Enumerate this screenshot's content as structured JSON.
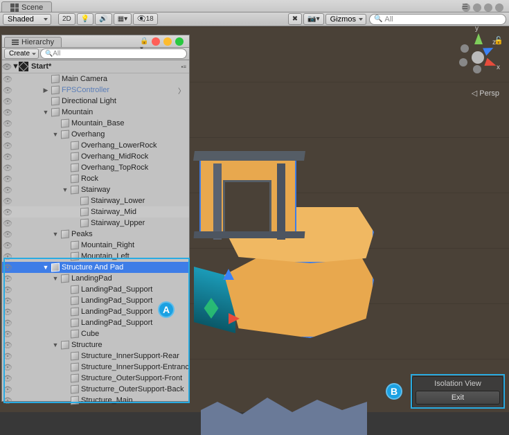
{
  "scene_tab": "Scene",
  "render_mode": "Shaded",
  "btn_2d": "2D",
  "gizmo_count": "18",
  "gizmos_label": "Gizmos",
  "search_placeholder": "All",
  "hierarchy_tab": "Hierarchy",
  "create_label": "Create",
  "hier_search_placeholder": "All",
  "scene_name": "Start*",
  "persp": "Persp",
  "axis_y": "y",
  "axis_x": "x",
  "axis_z": "z",
  "isolation_title": "Isolation View",
  "isolation_exit": "Exit",
  "marker_a": "A",
  "marker_b": "B",
  "tree": [
    {
      "d": 1,
      "name": "Main Camera",
      "arr": "",
      "link": false
    },
    {
      "d": 1,
      "name": "FPSController",
      "arr": "▶",
      "link": true,
      "chev": true
    },
    {
      "d": 1,
      "name": "Directional Light",
      "arr": "",
      "link": false
    },
    {
      "d": 1,
      "name": "Mountain",
      "arr": "▼",
      "link": false
    },
    {
      "d": 2,
      "name": "Mountain_Base",
      "arr": "",
      "link": false
    },
    {
      "d": 2,
      "name": "Overhang",
      "arr": "▼",
      "link": false
    },
    {
      "d": 3,
      "name": "Overhang_LowerRock",
      "arr": "",
      "link": false
    },
    {
      "d": 3,
      "name": "Overhang_MidRock",
      "arr": "",
      "link": false
    },
    {
      "d": 3,
      "name": "Overhang_TopRock",
      "arr": "",
      "link": false
    },
    {
      "d": 3,
      "name": "Rock",
      "arr": "",
      "link": false
    },
    {
      "d": 3,
      "name": "Stairway",
      "arr": "▼",
      "link": false
    },
    {
      "d": 4,
      "name": "Stairway_Lower",
      "arr": "",
      "link": false
    },
    {
      "d": 4,
      "name": "Stairway_Mid",
      "arr": "",
      "link": false,
      "hl": true
    },
    {
      "d": 4,
      "name": "Stairway_Upper",
      "arr": "",
      "link": false
    },
    {
      "d": 2,
      "name": "Peaks",
      "arr": "▼",
      "link": false
    },
    {
      "d": 3,
      "name": "Mountain_Right",
      "arr": "",
      "link": false
    },
    {
      "d": 3,
      "name": "Mountain_Left",
      "arr": "",
      "link": false
    },
    {
      "d": 1,
      "name": "Structure And Pad",
      "arr": "▼",
      "link": false,
      "sel": true
    },
    {
      "d": 2,
      "name": "LandingPad",
      "arr": "▼",
      "link": false
    },
    {
      "d": 3,
      "name": "LandingPad_Support",
      "arr": "",
      "link": false
    },
    {
      "d": 3,
      "name": "LandingPad_Support",
      "arr": "",
      "link": false
    },
    {
      "d": 3,
      "name": "LandingPad_Support",
      "arr": "",
      "link": false
    },
    {
      "d": 3,
      "name": "LandingPad_Support",
      "arr": "",
      "link": false
    },
    {
      "d": 3,
      "name": "Cube",
      "arr": "",
      "link": false
    },
    {
      "d": 2,
      "name": "Structure",
      "arr": "▼",
      "link": false
    },
    {
      "d": 3,
      "name": "Structure_InnerSupport-Rear",
      "arr": "",
      "link": false
    },
    {
      "d": 3,
      "name": "Structure_InnerSupport-Entranc",
      "arr": "",
      "link": false
    },
    {
      "d": 3,
      "name": "Structure_OuterSupport-Front",
      "arr": "",
      "link": false
    },
    {
      "d": 3,
      "name": "Structurre_OuterSupport-Back",
      "arr": "",
      "link": false
    },
    {
      "d": 3,
      "name": "Structure_Main",
      "arr": "",
      "link": false
    }
  ]
}
